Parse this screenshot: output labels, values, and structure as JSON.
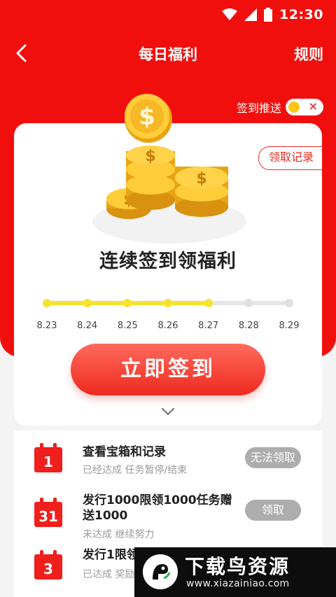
{
  "status_bar": {
    "time": "12:30"
  },
  "nav": {
    "title": "每日福利",
    "rules_label": "规则"
  },
  "push": {
    "label": "签到推送",
    "toggle_mark": "×",
    "enabled": false
  },
  "card": {
    "record_label": "领取记录",
    "headline": "连续签到领福利",
    "dates": [
      "8.23",
      "8.24",
      "8.25",
      "8.26",
      "8.27",
      "8.28",
      "8.29"
    ],
    "completed_days": 5,
    "signin_label": "立即签到"
  },
  "tasks": [
    {
      "day": "1",
      "title": "查看宝箱和记录",
      "subtitle": "已经达成 任务暂停/结束",
      "action": "无法领取"
    },
    {
      "day": "31",
      "title": "发行1000限领1000任务赠送1000",
      "subtitle": "未达成 继续努力",
      "action": "领取"
    },
    {
      "day": "3",
      "title": "发行1限领",
      "subtitle": "已达成 奖励",
      "action": ""
    }
  ],
  "watermark": {
    "title": "下载鸟资源",
    "url": "www.xiazainiao.com"
  },
  "colors": {
    "primary_red": "#f10f0e",
    "progress_yellow": "#f8e12d",
    "pill_gray": "#adadad"
  }
}
